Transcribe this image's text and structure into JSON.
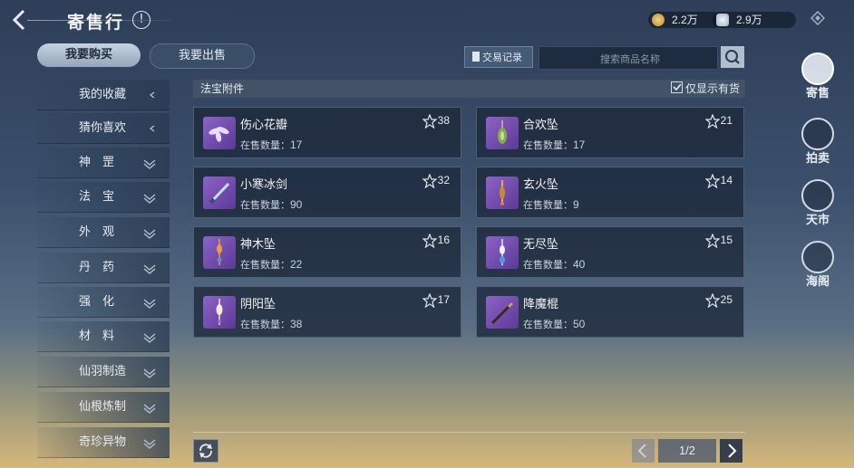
{
  "header": {
    "title": "寄售行",
    "info": "!",
    "gold": "2.2万",
    "silver": "2.9万"
  },
  "tabs": {
    "buy": "我要购买",
    "sell": "我要出售"
  },
  "toolbar": {
    "trade_record": "交易记录",
    "search_placeholder": "搜索商品名称"
  },
  "sidebar": {
    "items": [
      {
        "label": "我的收藏"
      },
      {
        "label": "猜你喜欢"
      },
      {
        "label": "神　罡"
      },
      {
        "label": "法　宝"
      },
      {
        "label": "外　观"
      },
      {
        "label": "丹　药"
      },
      {
        "label": "强　化"
      },
      {
        "label": "材　料"
      },
      {
        "label": "仙羽制造"
      },
      {
        "label": "仙根炼制"
      },
      {
        "label": "奇珍异物"
      }
    ]
  },
  "list": {
    "category": "法宝附件",
    "instock_label": "仅显示有货",
    "qty_label": "在售数量：",
    "items": [
      {
        "name": "伤心花瓣",
        "qty": "17",
        "fav": "38"
      },
      {
        "name": "合欢坠",
        "qty": "17",
        "fav": "21"
      },
      {
        "name": "小寒冰剑",
        "qty": "90",
        "fav": "32"
      },
      {
        "name": "玄火坠",
        "qty": "9",
        "fav": "14"
      },
      {
        "name": "神木坠",
        "qty": "22",
        "fav": "16"
      },
      {
        "name": "无尽坠",
        "qty": "40",
        "fav": "15"
      },
      {
        "name": "阴阳坠",
        "qty": "38",
        "fav": "17"
      },
      {
        "name": "降魔棍",
        "qty": "50",
        "fav": "25"
      }
    ]
  },
  "pagination": {
    "page": "1/2"
  },
  "rightnav": [
    {
      "label": "寄售"
    },
    {
      "label": "拍卖"
    },
    {
      "label": "天市"
    },
    {
      "label": "海阁"
    }
  ]
}
